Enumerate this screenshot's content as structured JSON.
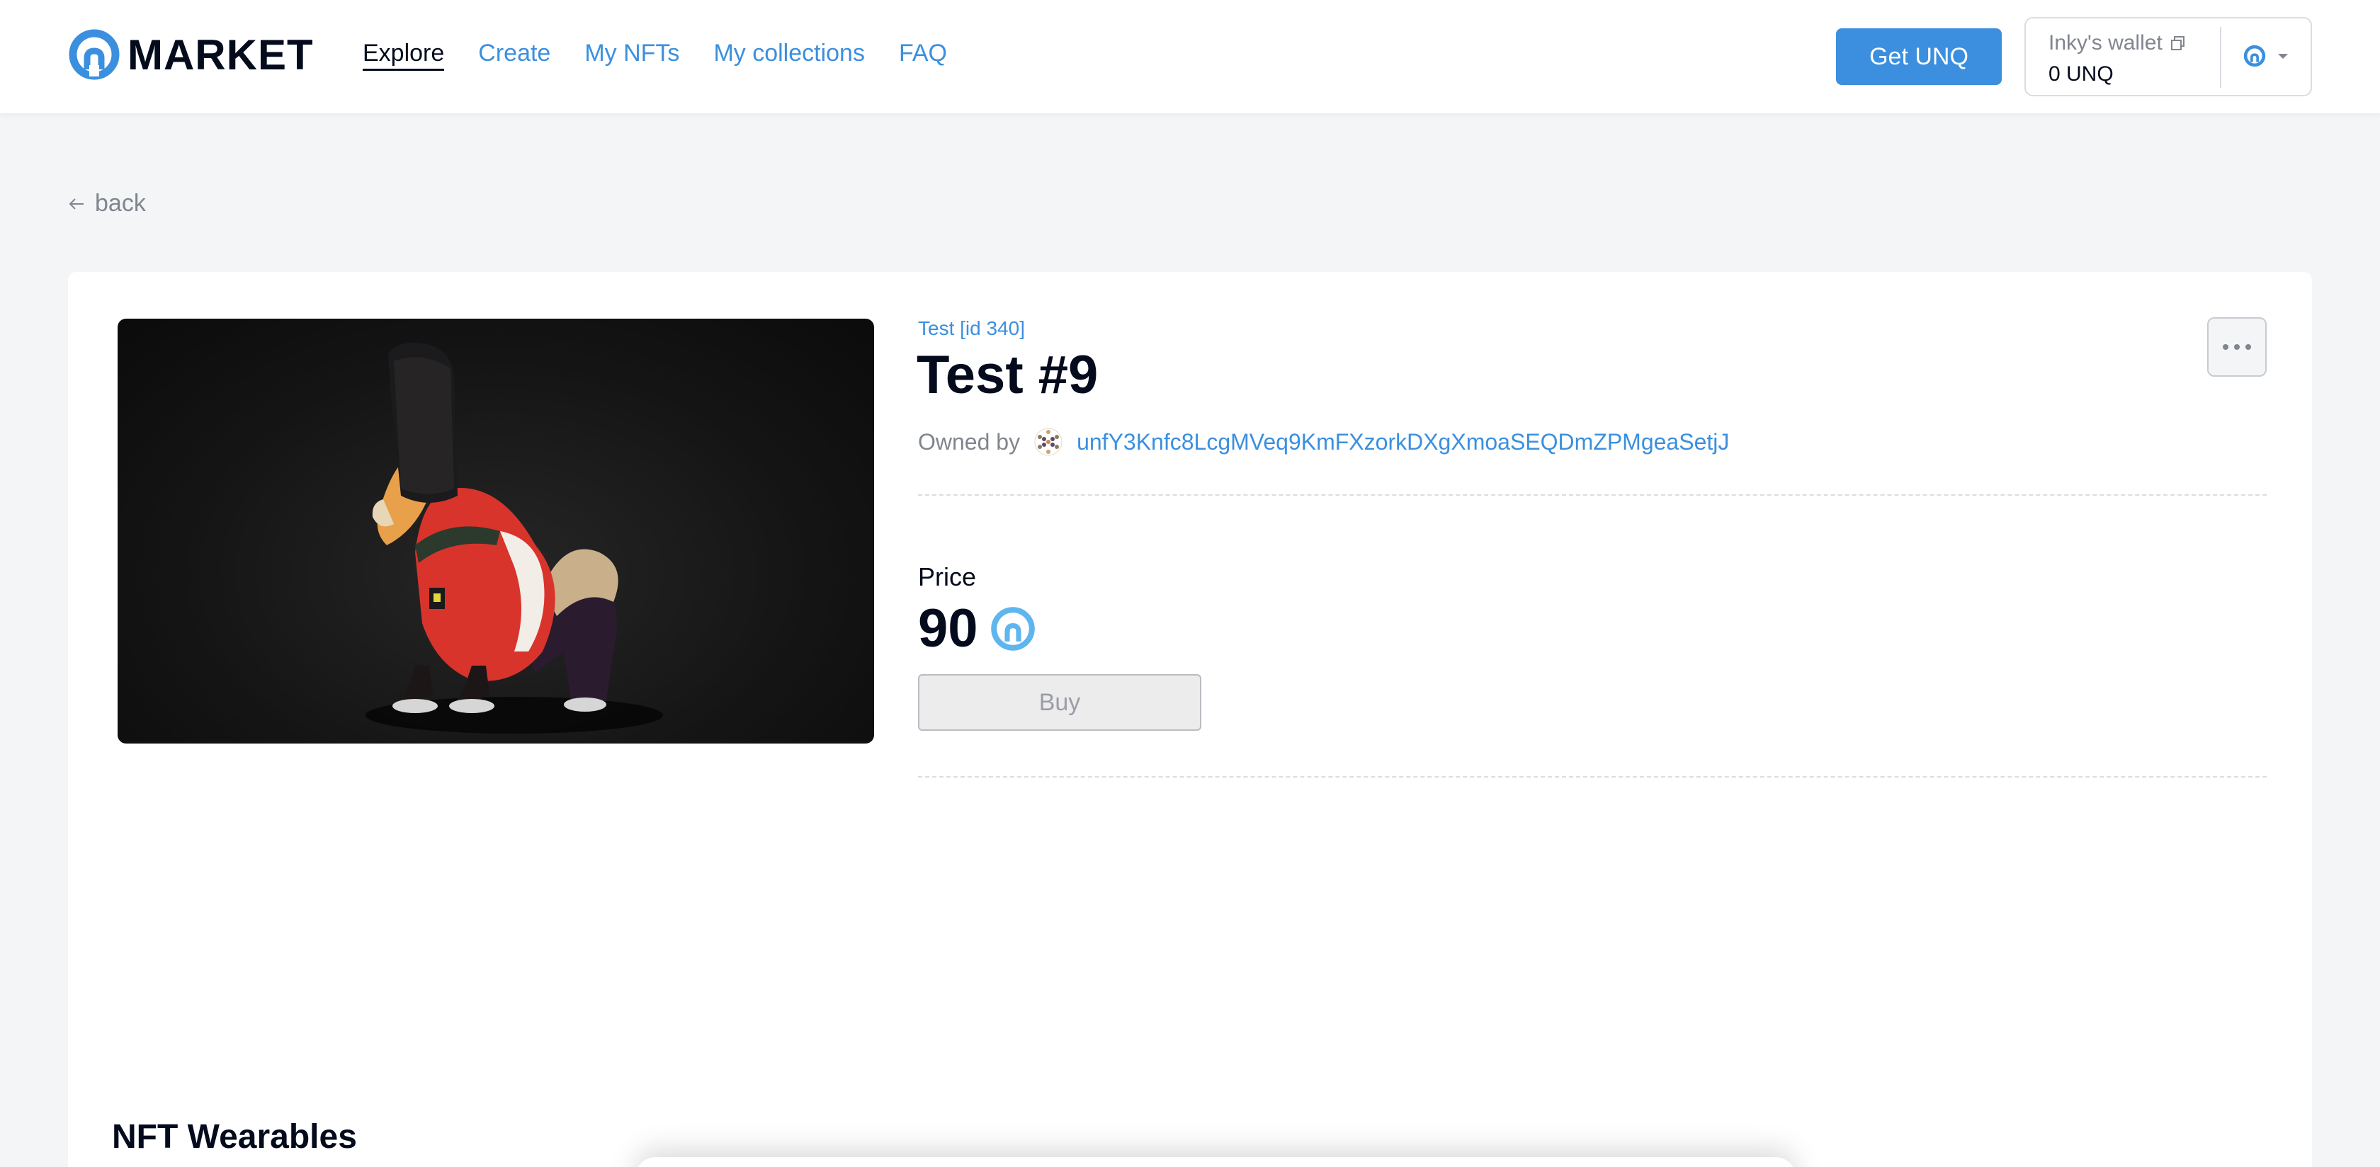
{
  "header": {
    "logo_text": "MARKET",
    "nav": [
      {
        "label": "Explore",
        "active": true
      },
      {
        "label": "Create",
        "active": false
      },
      {
        "label": "My NFTs",
        "active": false
      },
      {
        "label": "My collections",
        "active": false
      },
      {
        "label": "FAQ",
        "active": false
      }
    ],
    "get_button": "Get UNQ",
    "wallet": {
      "name": "Inky's wallet",
      "balance": "0 UNQ"
    }
  },
  "back_label": "back",
  "token": {
    "collection": "Test [id 340]",
    "title": "Test #9",
    "owned_by_label": "Owned by",
    "owner_address": "unfY3Knfc8LcgMVeq9KmFXzorkDXgXmoaSEQDmZPMgeaSetjJ",
    "price_label": "Price",
    "price_value": "90",
    "buy_label": "Buy"
  },
  "section_title": "NFT Wearables",
  "colors": {
    "accent": "#3b8fde",
    "text": "#040b1d",
    "muted": "#81858e",
    "background": "#f4f5f7"
  },
  "icons": {
    "logo": "unique-logo-icon",
    "copy": "copy-icon",
    "network": "unique-network-icon",
    "chevron": "chevron-down-icon",
    "back": "arrow-left-icon",
    "more": "more-icon",
    "avatar": "identicon-avatar",
    "currency": "unq-coin-icon"
  }
}
